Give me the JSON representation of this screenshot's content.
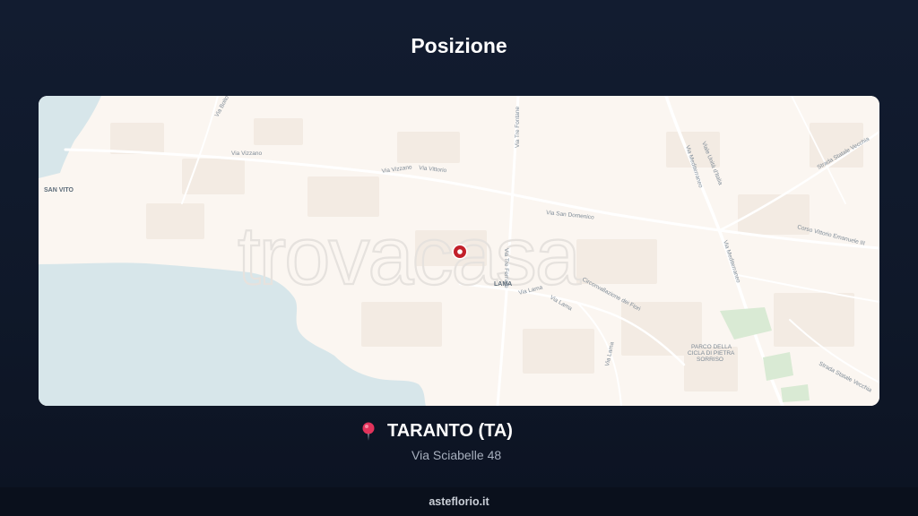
{
  "header": {
    "title": "Posizione"
  },
  "map": {
    "watermark": "trovacasa",
    "places": {
      "san_vito": "SAN VITO",
      "lama": "LAMA",
      "parco": [
        "PARCO DELLA",
        "CICLA DI PIETRA",
        "SORRISO"
      ]
    },
    "streets": {
      "via_vizzano": "Via Vizzano",
      "via_vizzano_2": "Via Vizzano",
      "via_vittorio": "Via Vittorio",
      "via_tre_fontane": "Via Tre Fontane",
      "via_tre_ferriate": "Via Tre Ferriate",
      "via_san_domenico": "Via San Domenico",
      "via_lama": "Via Lama",
      "via_lama_2": "Via Lama",
      "via_lama_3": "Via Lama",
      "circonvallazione": "Circonvallazione dei Fiori",
      "viale_unita": "Viale Unità d'Italia",
      "via_mediterraneo": "Via Mediterraneo",
      "via_mediterraneo_2": "Via Mediterraneo",
      "corso_vittorio": "Corso Vittorio Emanuele III",
      "strada_vecchia": "Strada Statale Vecchia",
      "strada_sud": "Strada Statale Vecchia",
      "via_nw": "Via Boito"
    },
    "colors": {
      "land": "#fbf6f1",
      "water": "#d7e6ea",
      "pin": "#c2202a",
      "park": "#d9ead4"
    }
  },
  "location": {
    "pin_icon": "round-pushpin-icon",
    "city": "TARANTO (TA)",
    "address": "Via Sciabelle 48"
  },
  "footer": {
    "site": "asteflorio.it"
  }
}
